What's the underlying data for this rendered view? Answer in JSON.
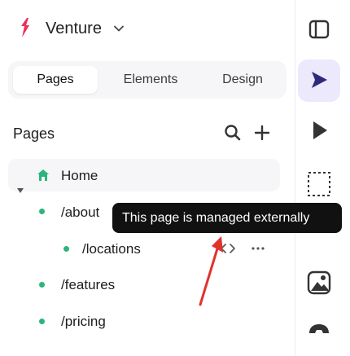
{
  "header": {
    "app_name": "Venture",
    "logo_icon": "framer-bolt-icon",
    "menu_icon": "chevron-down-icon"
  },
  "tabs": [
    {
      "label": "Pages",
      "active": true
    },
    {
      "label": "Elements",
      "active": false
    },
    {
      "label": "Design",
      "active": false
    }
  ],
  "pages_section": {
    "title": "Pages",
    "search_icon": "search-icon",
    "add_icon": "plus-icon"
  },
  "pages": [
    {
      "label": "Home",
      "icon": "home-icon"
    },
    {
      "label": "/about"
    },
    {
      "label": "/locations"
    },
    {
      "label": "/features"
    },
    {
      "label": "/pricing"
    }
  ],
  "row_actions": {
    "code_icon": "code-icon",
    "more_icon": "more-icon"
  },
  "tooltip": {
    "text": "This page is managed externally"
  },
  "toolbar": {
    "panel_icon": "panel-toggle-icon",
    "cursor_icon": "cursor-icon",
    "play_icon": "play-icon",
    "select_icon": "marquee-select-icon",
    "image_icon": "image-icon",
    "plugin_icon": "plugin-icon"
  },
  "colors": {
    "accent": "#ebe9fb",
    "accent_icon": "#2d2a7a",
    "status_dot": "#2bb57d",
    "annotation": "#e0332e",
    "tooltip_bg": "#111111"
  }
}
